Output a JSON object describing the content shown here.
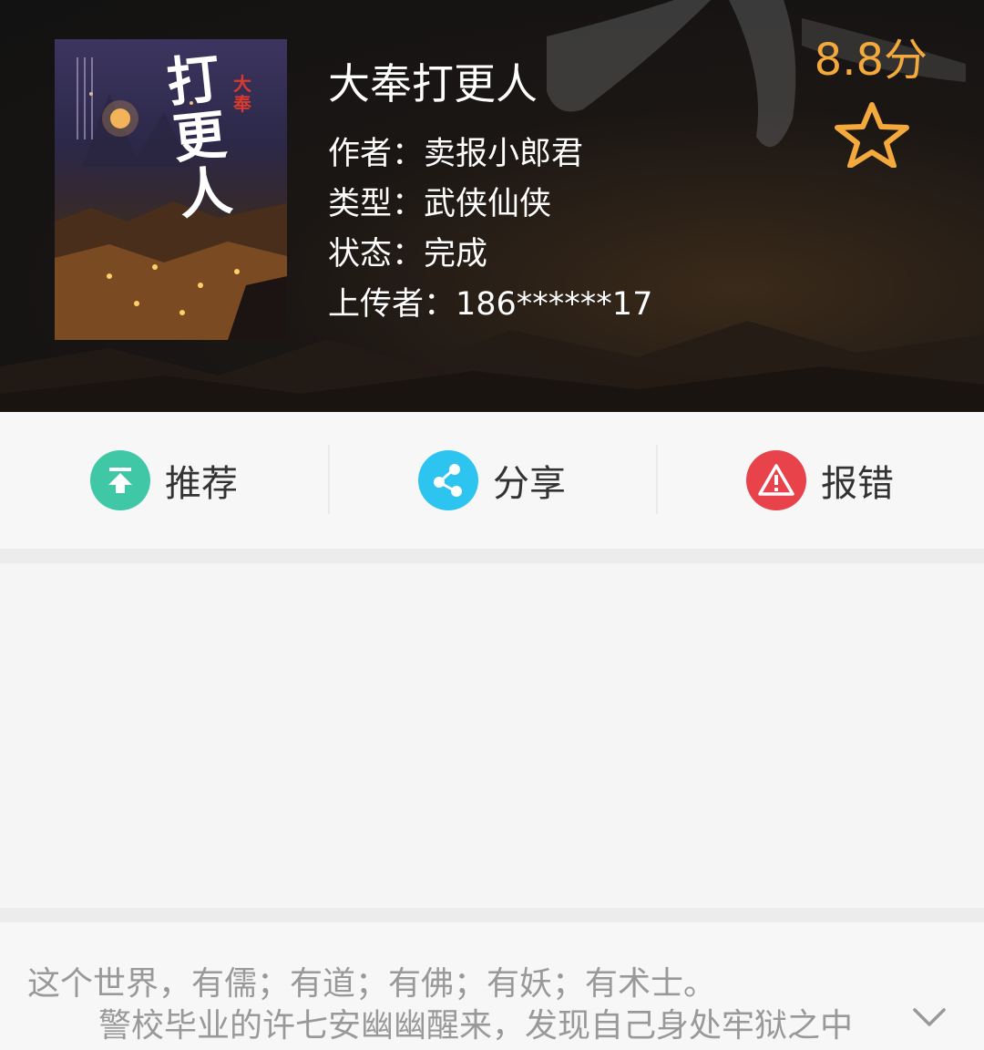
{
  "book": {
    "title": "大奉打更人",
    "author": "作者：卖报小郎君",
    "genre": "类型：武侠仙侠",
    "status": "状态：完成",
    "uploader": "上传者：186******17",
    "score": "8.8分",
    "cover_title": "打更人",
    "cover_badge": "大奉"
  },
  "actions": [
    {
      "label": "推荐",
      "icon": "upload-arrow-icon",
      "color": "#3fc7a6"
    },
    {
      "label": "分享",
      "icon": "share-icon",
      "color": "#2ec4f0"
    },
    {
      "label": "报错",
      "icon": "warning-icon",
      "color": "#e8434a"
    }
  ],
  "description": {
    "line1": "这个世界，有儒；有道；有佛；有妖；有术士。",
    "line2": "警校毕业的许七安幽幽醒来，发现自己身处牢狱之中"
  },
  "icons": {
    "favorite": "star-outline-icon",
    "expand": "chevron-down-icon"
  },
  "colors": {
    "score": "#f3a93b",
    "text_secondary": "#999999"
  }
}
